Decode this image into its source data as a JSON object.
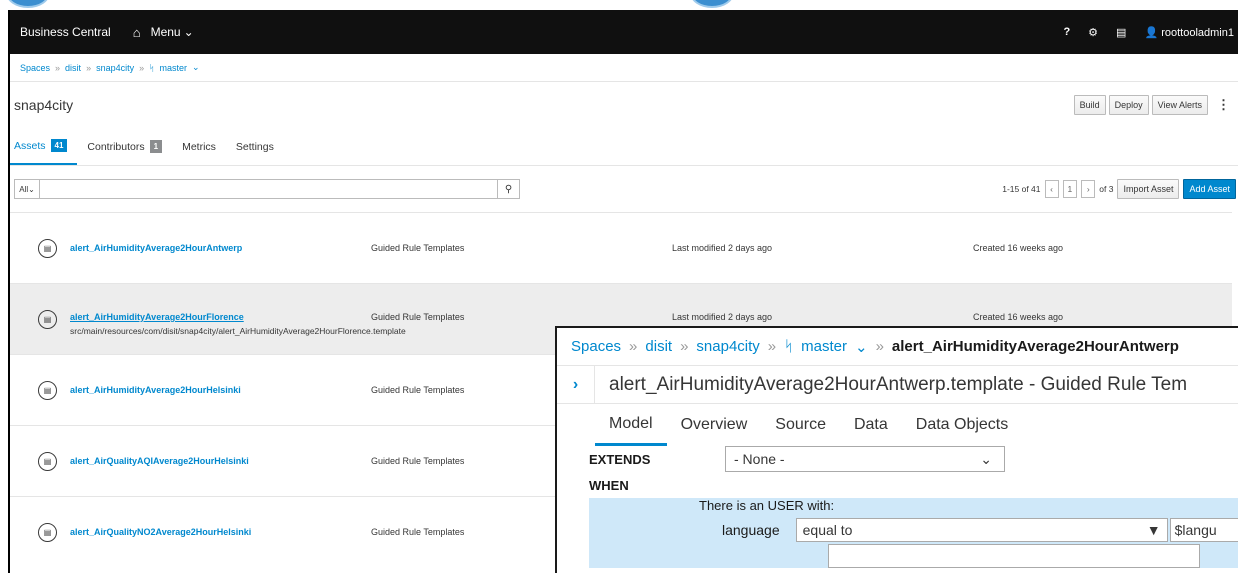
{
  "navbar": {
    "brand": "Business Central",
    "menu_label": "Menu",
    "help": "?",
    "user": "roottooladmin1"
  },
  "breadcrumb": {
    "items": [
      "Spaces",
      "disit",
      "snap4city",
      "master"
    ],
    "separator": "»"
  },
  "project": {
    "title": "snap4city",
    "buttons": {
      "build": "Build",
      "deploy": "Deploy",
      "view_alerts": "View Alerts"
    }
  },
  "tabs": {
    "assets": {
      "label": "Assets",
      "count": "41"
    },
    "contributors": {
      "label": "Contributors",
      "count": "1"
    },
    "metrics": "Metrics",
    "settings": "Settings"
  },
  "filter": {
    "type_select": "All",
    "search_value": "",
    "range": "1-15 of 41",
    "page": "1",
    "of_pages": "of 3",
    "import_label": "Import Asset",
    "add_label": "Add Asset"
  },
  "assets": [
    {
      "name": "alert_AirHumidityAverage2HourAntwerp",
      "type": "Guided Rule Templates",
      "modified": "Last modified 2 days ago",
      "created": "Created 16 weeks ago"
    },
    {
      "name": "alert_AirHumidityAverage2HourFlorence",
      "path": "src/main/resources/com/disit/snap4city/alert_AirHumidityAverage2HourFlorence.template",
      "type": "Guided Rule Templates",
      "modified": "Last modified 2 days ago",
      "created": "Created 16 weeks ago"
    },
    {
      "name": "alert_AirHumidityAverage2HourHelsinki",
      "type": "Guided Rule Templates"
    },
    {
      "name": "alert_AirQualityAQIAverage2HourHelsinki",
      "type": "Guided Rule Templates"
    },
    {
      "name": "alert_AirQualityNO2Average2HourHelsinki",
      "type": "Guided Rule Templates"
    }
  ],
  "editor": {
    "breadcrumb": [
      "Spaces",
      "disit",
      "snap4city",
      "master",
      "alert_AirHumidityAverage2HourAntwerp"
    ],
    "title": "alert_AirHumidityAverage2HourAntwerp.template - Guided Rule Tem",
    "tabs": [
      "Model",
      "Overview",
      "Source",
      "Data",
      "Data Objects"
    ],
    "extends_label": "EXTENDS",
    "extends_value": "- None -",
    "when_label": "WHEN",
    "condition": "There is an USER with:",
    "field": "language",
    "operator": "equal to",
    "value": "$langu"
  },
  "colors": {
    "accent": "#0088ce",
    "navbar": "#101010",
    "condition_bg": "#cfe8f9"
  }
}
